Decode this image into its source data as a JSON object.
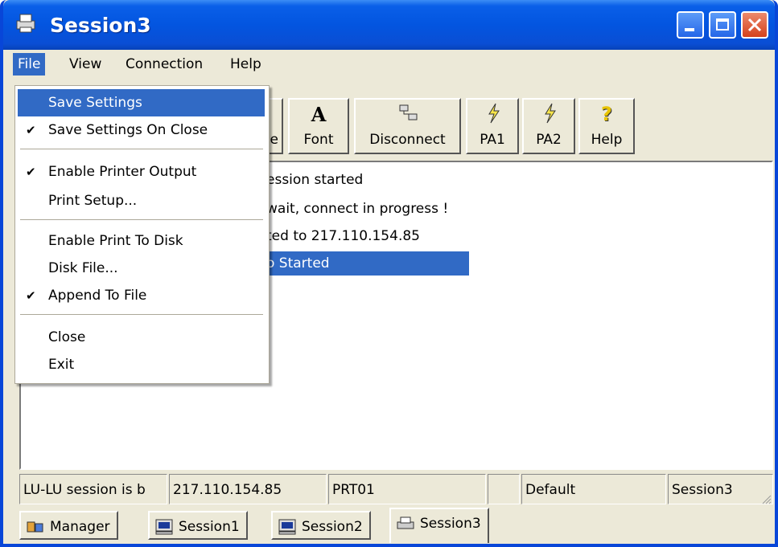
{
  "window": {
    "title": "Session3"
  },
  "menubar": {
    "file": "File",
    "view": "View",
    "connection": "Connection",
    "help": "Help"
  },
  "file_menu": {
    "save_settings": "Save Settings",
    "save_settings_on_close": "Save Settings On Close",
    "enable_printer_output": "Enable Printer Output",
    "print_setup": "Print Setup...",
    "enable_print_to_disk": "Enable Print To Disk",
    "disk_file": "Disk File...",
    "append_to_file": "Append To File",
    "close": "Close",
    "exit": "Exit"
  },
  "toolbar": {
    "hidden_partial": "e",
    "font": "Font",
    "disconnect": "Disconnect",
    "pa1": "PA1",
    "pa2": "PA2",
    "help": "Help"
  },
  "log": {
    "lines": [
      "ession started",
      "wait, connect in progress !",
      "ted to 217.110.154.85",
      "o Started"
    ]
  },
  "status": {
    "session_state": "LU-LU session is b",
    "host": "217.110.154.85",
    "device": "PRT01",
    "empty": "",
    "profile": "Default",
    "session": "Session3"
  },
  "tabs": {
    "manager": "Manager",
    "session1": "Session1",
    "session2": "Session2",
    "session3": "Session3"
  },
  "colors": {
    "titlebar": "#0355e0",
    "highlight": "#316ac5",
    "face": "#ece9d8"
  }
}
